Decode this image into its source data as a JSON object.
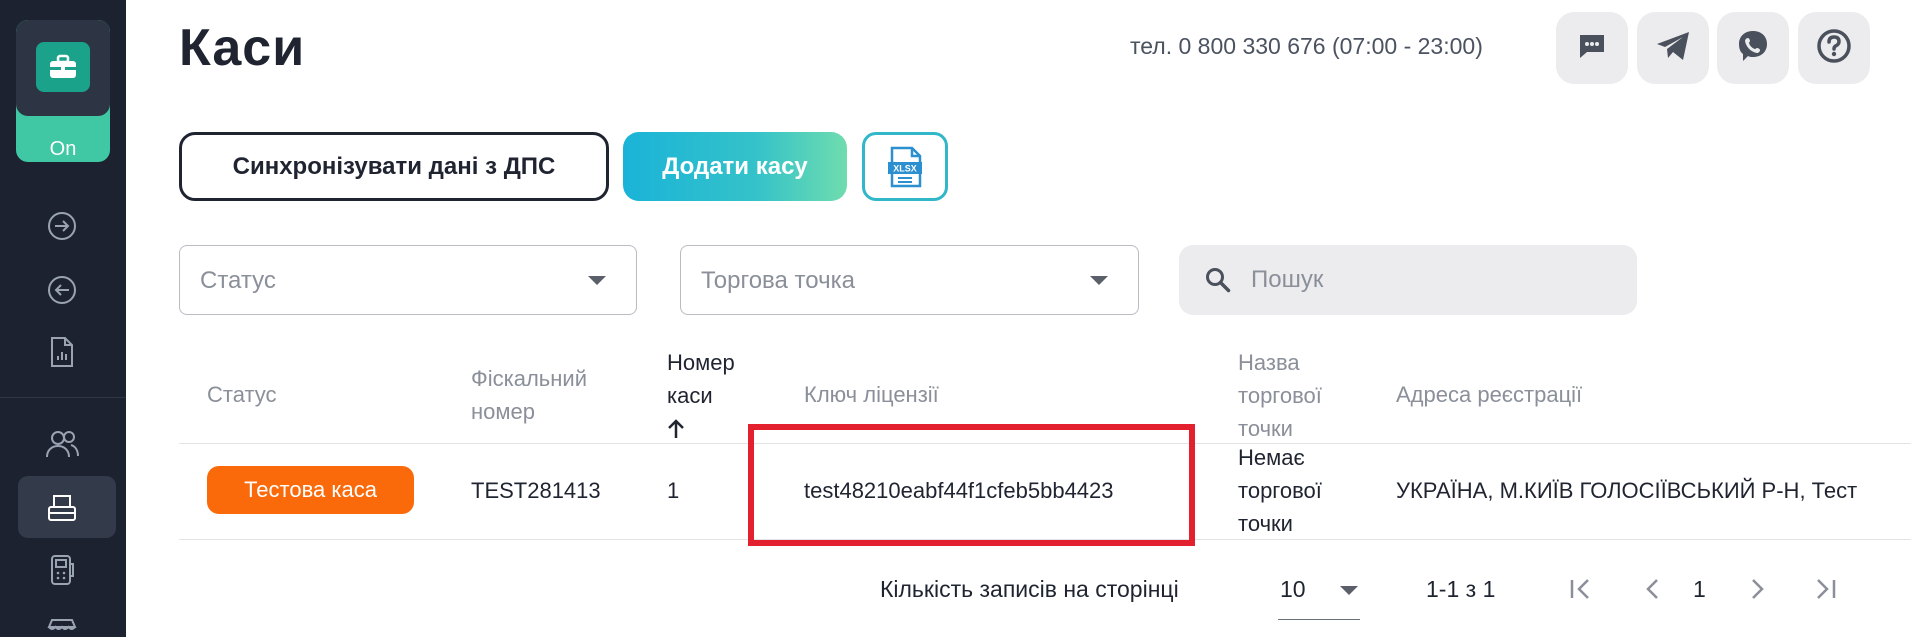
{
  "sidebar": {
    "brand_state": "On",
    "icons": [
      "arrow-right-circle-icon",
      "arrow-left-circle-icon",
      "report-icon",
      "users-icon",
      "cash-register-icon",
      "terminal-icon",
      "shop-icon"
    ]
  },
  "header": {
    "title": "Каси",
    "phone": "тел. 0 800 330 676 (07:00 - 23:00)",
    "buttons": [
      "chat-icon",
      "telegram-icon",
      "viber-icon",
      "help-icon"
    ]
  },
  "actions": {
    "sync_label": "Синхронізувати дані з ДПС",
    "add_label": "Додати касу",
    "export_icon": "xlsx-icon",
    "export_text": "XLSX"
  },
  "filters": {
    "status_placeholder": "Статус",
    "point_placeholder": "Торгова точка",
    "search_placeholder": "Пошук"
  },
  "table": {
    "headers": {
      "status": "Статус",
      "fiscal": [
        "Фіскальний",
        "номер"
      ],
      "number": [
        "Номер",
        "каси"
      ],
      "license": "Ключ ліцензії",
      "point_name": [
        "Назва",
        "торгової",
        "точки"
      ],
      "address": "Адреса реєстрації"
    },
    "rows": [
      {
        "status": "Тестова каса",
        "fiscal": "TEST281413",
        "number": "1",
        "license": "test48210eabf44f1cfeb5bb4423",
        "point_name": [
          "Немає",
          "торгової",
          "точки"
        ],
        "address": "УКРАЇНА, М.КИЇВ ГОЛОСІЇВСЬКИЙ Р-Н, Тест"
      }
    ]
  },
  "pagination": {
    "per_page_label": "Кількість записів на сторінці",
    "per_page_value": "10",
    "range": "1-1 з 1",
    "current_page": "1"
  },
  "colors": {
    "sidebar_bg": "#1c2230",
    "brand_green": "#40c7a4",
    "badge_orange": "#fa6a0a",
    "highlight_red": "#e3202e",
    "accent_gradient_start": "#1ab3d8",
    "accent_gradient_end": "#6fdcae"
  }
}
